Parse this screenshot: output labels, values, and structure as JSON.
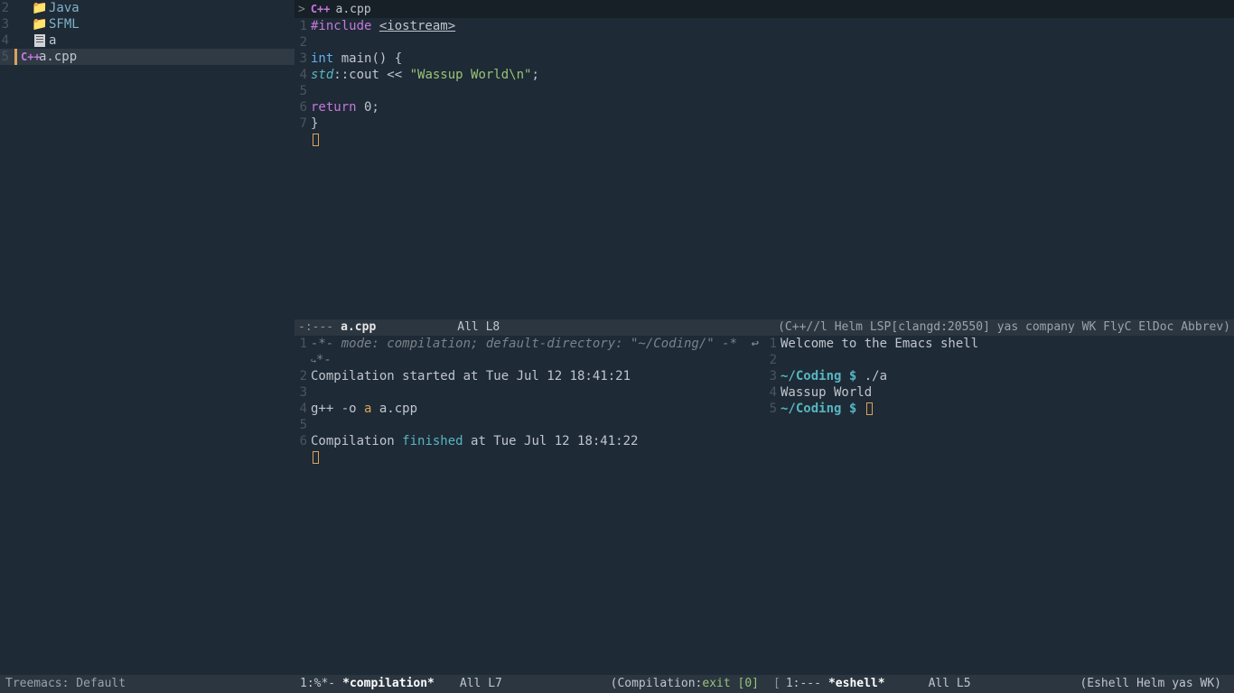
{
  "sidebar": {
    "items": [
      {
        "num": "2",
        "type": "folder",
        "label": "Java"
      },
      {
        "num": "3",
        "type": "folder",
        "label": "SFML"
      },
      {
        "num": "4",
        "type": "file",
        "label": "a"
      },
      {
        "num": "5",
        "type": "cpp",
        "label": "a.cpp",
        "selected": true
      }
    ]
  },
  "tab": {
    "icon": "C++",
    "name": "a.cpp"
  },
  "code": {
    "lines": [
      {
        "n": "1",
        "segments": [
          {
            "t": "#include ",
            "c": "k-pre"
          },
          {
            "t": "<iostream>",
            "c": "k-inc"
          }
        ]
      },
      {
        "n": "2",
        "segments": []
      },
      {
        "n": "3",
        "segments": [
          {
            "t": "int",
            "c": "k-type"
          },
          {
            "t": " main",
            "c": "k-plain"
          },
          {
            "t": "() {",
            "c": "k-plain"
          }
        ]
      },
      {
        "n": "4",
        "segments": [
          {
            "t": "  ",
            "c": "k-plain"
          },
          {
            "t": "std",
            "c": "k-ns"
          },
          {
            "t": "::cout << ",
            "c": "k-plain"
          },
          {
            "t": "\"Wassup World\\n\"",
            "c": "k-str"
          },
          {
            "t": ";",
            "c": "k-plain"
          }
        ]
      },
      {
        "n": "5",
        "segments": []
      },
      {
        "n": "6",
        "segments": [
          {
            "t": "  ",
            "c": "k-plain"
          },
          {
            "t": "return",
            "c": "k-kw"
          },
          {
            "t": " 0;",
            "c": "k-plain"
          }
        ]
      },
      {
        "n": "7",
        "segments": [
          {
            "t": "}",
            "c": "k-plain"
          }
        ]
      }
    ]
  },
  "modeline_top": {
    "left": "-:---",
    "name": "a.cpp",
    "pos": "All L8",
    "modes": "(C++//l Helm LSP[clangd:20550] yas company WK FlyC ElDoc Abbrev)"
  },
  "compilation": {
    "lines": [
      {
        "n": "1",
        "html": "-*- mode: compilation; default-directory: \"~/Coding/\" -*"
      },
      {
        "n": "",
        "html": "*-"
      },
      {
        "n": "2",
        "html": "Compilation started at Tue Jul 12 18:41:21"
      },
      {
        "n": "3",
        "html": ""
      },
      {
        "n": "4",
        "html_parts": [
          {
            "t": "g++ -o ",
            "c": "comp-plain"
          },
          {
            "t": "a",
            "c": "comp-file"
          },
          {
            "t": " a.cpp",
            "c": "comp-plain"
          }
        ]
      },
      {
        "n": "5",
        "html": ""
      },
      {
        "n": "6",
        "html_parts": [
          {
            "t": "Compilation ",
            "c": "comp-plain"
          },
          {
            "t": "finished",
            "c": "comp-fin"
          },
          {
            "t": " at Tue Jul 12 18:41:22",
            "c": "comp-plain"
          }
        ]
      }
    ]
  },
  "eshell": {
    "lines": [
      {
        "n": "1",
        "parts": [
          {
            "t": "Welcome to the Emacs shell",
            "c": "comp-plain"
          }
        ]
      },
      {
        "n": "2",
        "parts": []
      },
      {
        "n": "3",
        "parts": [
          {
            "t": "~/Coding $",
            "c": "esh-prompt"
          },
          {
            "t": " ./a",
            "c": "comp-plain"
          }
        ]
      },
      {
        "n": "4",
        "parts": [
          {
            "t": "Wassup World",
            "c": "comp-plain"
          }
        ]
      },
      {
        "n": "5",
        "parts": [
          {
            "t": "~/Coding $",
            "c": "esh-prompt"
          },
          {
            "t": " ",
            "c": "comp-plain"
          }
        ]
      }
    ]
  },
  "bottom": {
    "tree": "Treemacs: Default",
    "comp_left": "1:%*-",
    "comp_name": "*compilation*",
    "comp_pos": "All L7",
    "comp_mode_pre": "(Compilation:",
    "comp_mode_exit": "exit",
    "comp_mode_num": " [0]",
    "esh_left": "1:---",
    "esh_name": "*eshell*",
    "esh_pos": "All L5",
    "esh_modes": "(Eshell Helm yas WK)"
  }
}
